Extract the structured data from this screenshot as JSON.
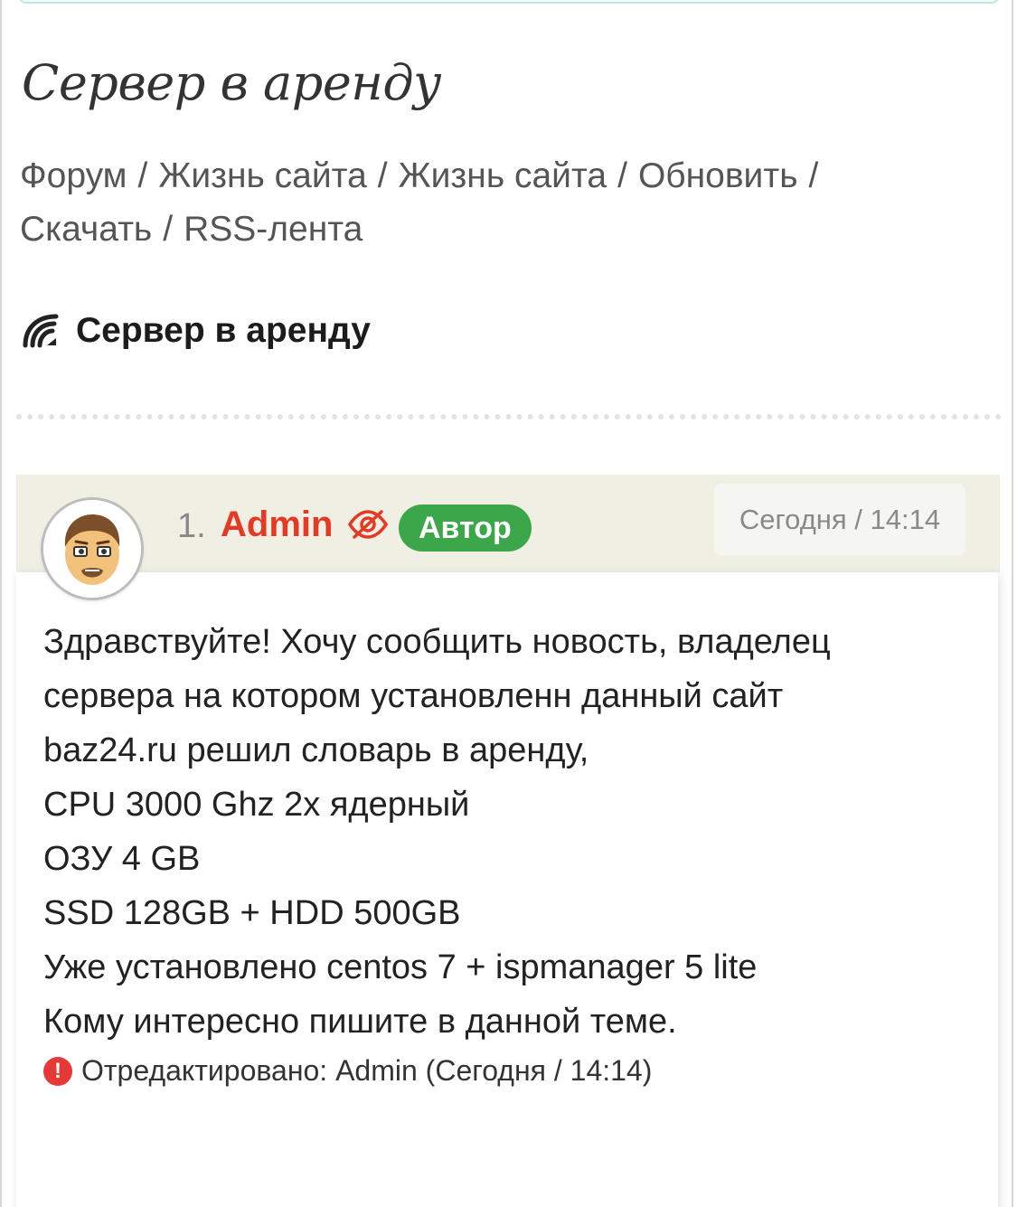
{
  "site": {
    "title": "Сервер в аренду"
  },
  "breadcrumb": [
    {
      "label": "Форум"
    },
    {
      "label": "Жизнь сайта"
    },
    {
      "label": "Жизнь сайта"
    },
    {
      "label": "Обновить"
    },
    {
      "label": "Скачать"
    },
    {
      "label": "RSS-лента"
    }
  ],
  "topic": {
    "icon": "feed-icon",
    "title": "Сервер в аренду"
  },
  "post": {
    "number": "1.",
    "author": "Admin",
    "author_color": "#e53925",
    "hidden_icon": "eye-slash-icon",
    "badge": "Автор",
    "badge_color": "#3ba64a",
    "date": "Сегодня / 14:14",
    "lines": [
      "Здравствуйте! Хочу сообщить новость, владелец",
      "сервера на котором установленн данный сайт",
      "baz24.ru решил словарь в аренду,",
      "CPU 3000 Ghz 2x ядерный",
      "ОЗУ 4 GB",
      "SSD 128GB + HDD 500GB",
      "Уже установлено centos 7 + ispmanager 5 lite",
      "Кому интересно пишите в данной теме."
    ],
    "edit_icon": "exclamation-circle-icon",
    "edited_note": "Отредактировано: Admin (Сегодня / 14:14)"
  }
}
